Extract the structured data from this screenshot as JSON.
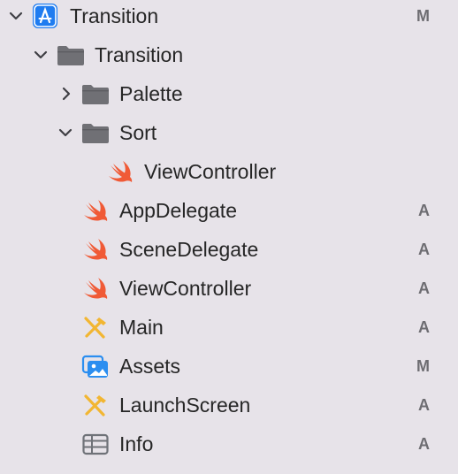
{
  "navigator": {
    "colors": {
      "background": "#e7e3e9",
      "text": "#262626",
      "status": "#6e6d72",
      "folder": "#707075",
      "swift": "#f05a36",
      "project": "#1f7cf0",
      "interface_builder": "#f2b632",
      "assets": "#2b8ef0",
      "plist": "#6f7278"
    },
    "items": [
      {
        "label": "Transition",
        "icon": "xcode-project-icon",
        "disclosure": "expanded",
        "status": "M"
      },
      {
        "label": "Transition",
        "icon": "folder-icon",
        "disclosure": "expanded",
        "status": ""
      },
      {
        "label": "Palette",
        "icon": "folder-icon",
        "disclosure": "collapsed",
        "status": ""
      },
      {
        "label": "Sort",
        "icon": "folder-icon",
        "disclosure": "expanded",
        "status": ""
      },
      {
        "label": "ViewController",
        "icon": "swift-file-icon",
        "disclosure": "none",
        "status": ""
      },
      {
        "label": "AppDelegate",
        "icon": "swift-file-icon",
        "disclosure": "none",
        "status": "A"
      },
      {
        "label": "SceneDelegate",
        "icon": "swift-file-icon",
        "disclosure": "none",
        "status": "A"
      },
      {
        "label": "ViewController",
        "icon": "swift-file-icon",
        "disclosure": "none",
        "status": "A"
      },
      {
        "label": "Main",
        "icon": "storyboard-icon",
        "disclosure": "none",
        "status": "A"
      },
      {
        "label": "Assets",
        "icon": "asset-catalog-icon",
        "disclosure": "none",
        "status": "M"
      },
      {
        "label": "LaunchScreen",
        "icon": "storyboard-icon",
        "disclosure": "none",
        "status": "A"
      },
      {
        "label": "Info",
        "icon": "plist-icon",
        "disclosure": "none",
        "status": "A"
      }
    ]
  }
}
